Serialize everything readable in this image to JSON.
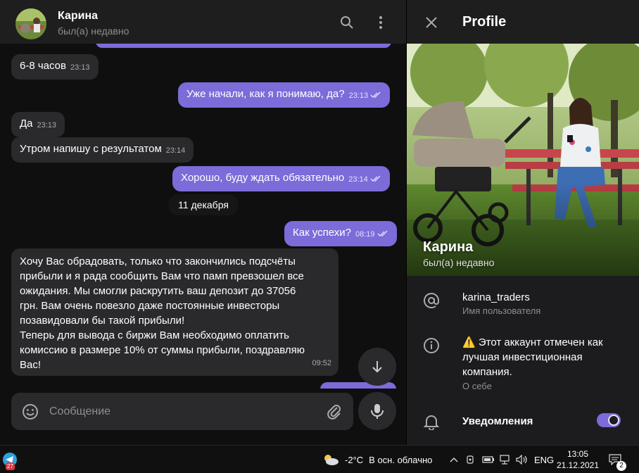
{
  "chat": {
    "contact_name": "Карина",
    "contact_status": "был(а) недавно",
    "messages": [
      {
        "text": "6-8 часов",
        "time": "23:13"
      },
      {
        "text": "Уже начали, как я понимаю, да?",
        "time": "23:13"
      },
      {
        "text": "Да",
        "time": "23:13"
      },
      {
        "text": "Утром напишу с результатом",
        "time": "23:14"
      },
      {
        "text": "Хорошо, буду ждать обязательно",
        "time": "23:14"
      },
      {
        "text": "Как успехи?",
        "time": "08:19"
      },
      {
        "text": "Хочу Вас обрадовать, только что закончились подсчёты\nприбыли и я рада сообщить Вам что памп превзошел все\nожидания. Мы смогли раскрутить ваш депозит до  37056\nгрн. Вам очень повезло даже постоянные инвесторы\nпозавидовали бы такой прибыли!\nТеперь для вывода с биржи Вам необходимо оплатить\nкомиссию в размере 10% от суммы прибыли, поздравляю\nВас!",
        "time": "09:52"
      }
    ],
    "date_separator": "11 декабря",
    "composer_placeholder": "Сообщение"
  },
  "profile": {
    "title": "Profile",
    "name": "Карина",
    "status": "был(а) недавно",
    "username": "karina_traders",
    "username_label": "Имя пользователя",
    "bio": "⚠️ Этот аккаунт отмечен как лучшая инвестиционная компания.",
    "bio_label": "О себе",
    "notifications_label": "Уведомления",
    "notifications_on": true
  },
  "taskbar": {
    "telegram_badge": "27",
    "temperature": "-2°C",
    "weather": "В осн. облачно",
    "language": "ENG",
    "time": "13:05",
    "date": "21.12.2021",
    "notifications_count": "2"
  },
  "colors": {
    "accent": "#7b6cd9",
    "incoming_bubble": "#2a2a2c",
    "background": "#0f0f0f",
    "panel": "#1c1c1e"
  }
}
